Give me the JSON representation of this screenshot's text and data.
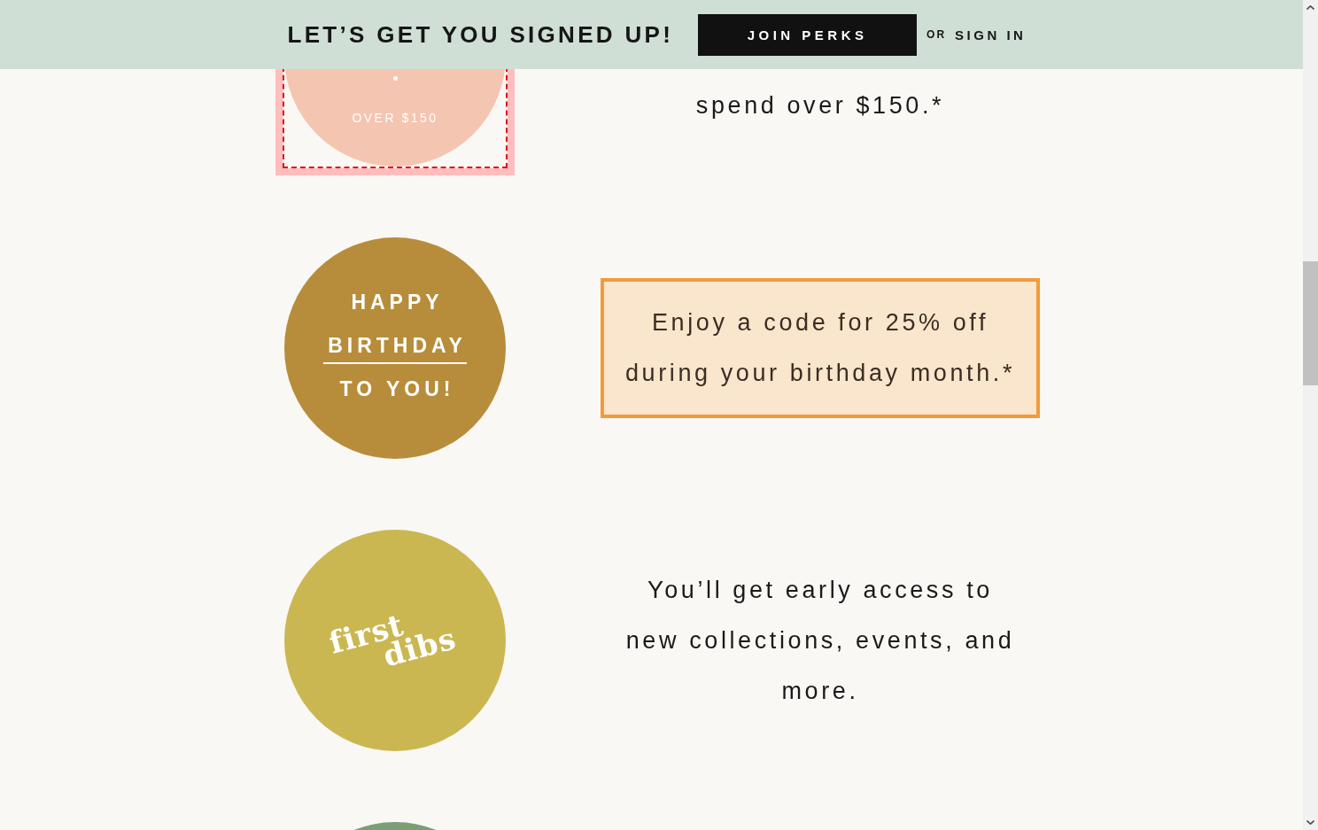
{
  "signup_banner": {
    "title": "LET’S GET YOU SIGNED UP!",
    "join_button": "JOIN PERKS",
    "or_label": "OR",
    "sign_in_link": "SIGN IN"
  },
  "perks": [
    {
      "badge": {
        "kind": "label",
        "color": "#f4c5b1",
        "caption": "OVER $150",
        "highlighted": true
      },
      "description": {
        "lines": [
          "spend over $150.*"
        ],
        "highlighted": false
      }
    },
    {
      "badge": {
        "kind": "stacked",
        "color": "#b78d3b",
        "highlighted": false,
        "lines": [
          {
            "text": "HAPPY",
            "underlined": false
          },
          {
            "text": "BIRTHDAY",
            "underlined": true
          },
          {
            "text": "TO YOU!",
            "underlined": false
          }
        ]
      },
      "description": {
        "lines": [
          "Enjoy a code for 25% off",
          "during your birthday month.*"
        ],
        "highlighted": true
      }
    },
    {
      "badge": {
        "kind": "script",
        "color": "#cbb752",
        "highlighted": false,
        "lines": [
          "first",
          "dibs"
        ]
      },
      "description": {
        "lines": [
          "You’ll get early access to",
          "new collections, events, and",
          "more."
        ],
        "highlighted": false
      }
    },
    {
      "badge": {
        "kind": "blank",
        "color": "#7b9e77",
        "highlighted": false
      }
    }
  ]
}
